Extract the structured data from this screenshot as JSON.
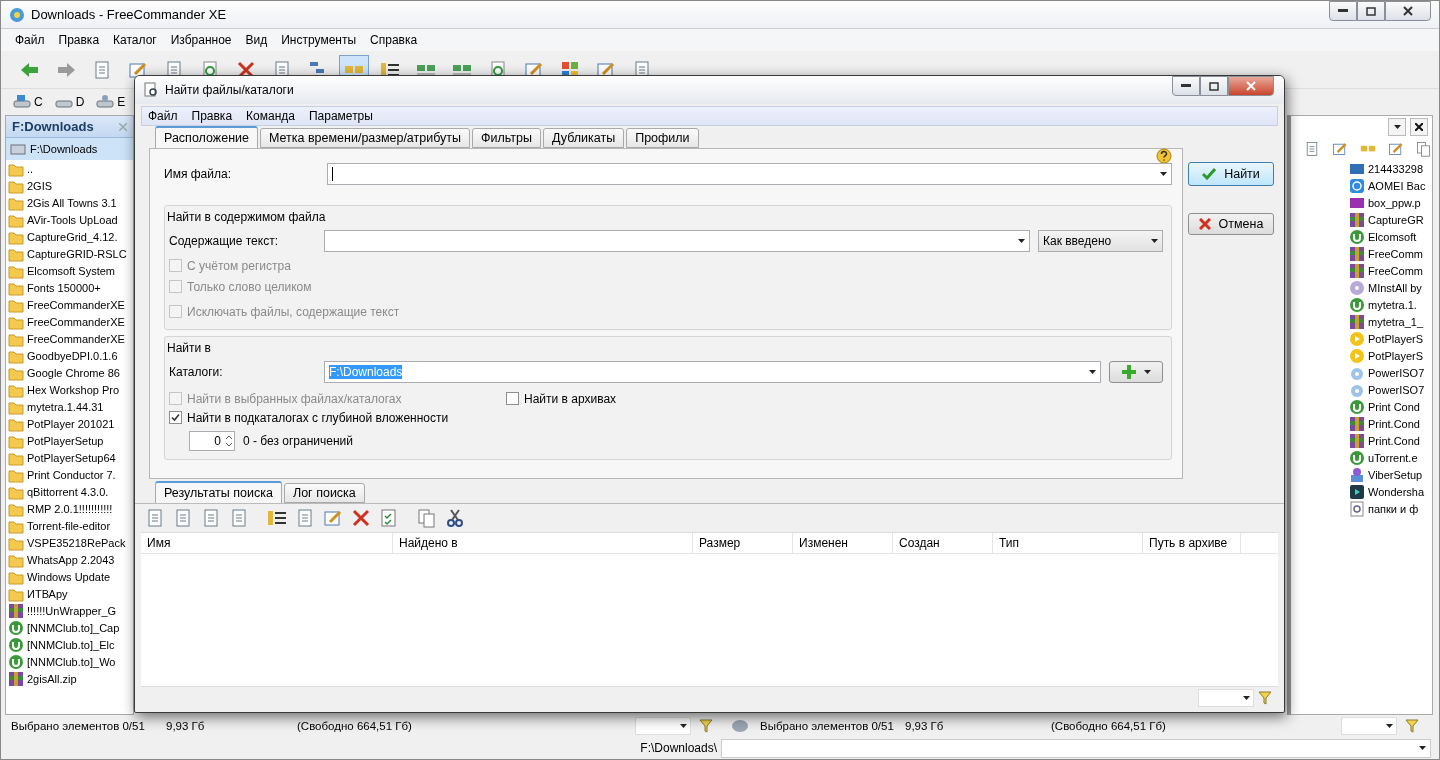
{
  "window": {
    "title": "Downloads - FreeCommander XE"
  },
  "menu": [
    "Файл",
    "Правка",
    "Каталог",
    "Избранное",
    "Вид",
    "Инструменты",
    "Справка"
  ],
  "drives": [
    {
      "label": "C",
      "kind": "system"
    },
    {
      "label": "D",
      "kind": "disk"
    },
    {
      "label": "E",
      "kind": "network"
    }
  ],
  "left_panel": {
    "tab": "F:Downloads",
    "path": "F:\\Downloads",
    "items": [
      {
        "name": "..",
        "kind": "folder"
      },
      {
        "name": "2GIS",
        "kind": "folder"
      },
      {
        "name": "2Gis All Towns 3.1",
        "kind": "folder"
      },
      {
        "name": "AVir-Tools UpLoad",
        "kind": "folder"
      },
      {
        "name": "CaptureGrid_4.12.",
        "kind": "folder"
      },
      {
        "name": "CaptureGRID-RSLC",
        "kind": "folder"
      },
      {
        "name": "Elcomsoft System",
        "kind": "folder"
      },
      {
        "name": "Fonts 150000+",
        "kind": "folder"
      },
      {
        "name": "FreeCommanderXE",
        "kind": "folder"
      },
      {
        "name": "FreeCommanderXE",
        "kind": "folder"
      },
      {
        "name": "FreeCommanderXE",
        "kind": "folder"
      },
      {
        "name": "GoodbyeDPI.0.1.6",
        "kind": "folder"
      },
      {
        "name": "Google Chrome 86",
        "kind": "folder"
      },
      {
        "name": "Hex Workshop Pro",
        "kind": "folder"
      },
      {
        "name": "mytetra.1.44.31",
        "kind": "folder"
      },
      {
        "name": "PotPlayer 201021",
        "kind": "folder"
      },
      {
        "name": "PotPlayerSetup",
        "kind": "folder"
      },
      {
        "name": "PotPlayerSetup64",
        "kind": "folder"
      },
      {
        "name": "Print Conductor 7.",
        "kind": "folder"
      },
      {
        "name": "qBittorrent 4.3.0.",
        "kind": "folder"
      },
      {
        "name": "RMP 2.0.1!!!!!!!!!!!",
        "kind": "folder"
      },
      {
        "name": "Torrent-file-editor",
        "kind": "folder"
      },
      {
        "name": "VSPE35218RePack",
        "kind": "folder"
      },
      {
        "name": "WhatsApp 2.2043",
        "kind": "folder"
      },
      {
        "name": "Windows Update",
        "kind": "folder"
      },
      {
        "name": "ИТВАру",
        "kind": "folder"
      },
      {
        "name": "!!!!!!UnWrapper_G",
        "kind": "archive"
      },
      {
        "name": "[NNMClub.to]_Cap",
        "kind": "torrent"
      },
      {
        "name": "[NNMClub.to]_Elc",
        "kind": "torrent"
      },
      {
        "name": "[NNMClub.to]_Wo",
        "kind": "torrent"
      },
      {
        "name": "2gisAll.zip",
        "kind": "archive"
      }
    ]
  },
  "right_panel": {
    "items": [
      {
        "name": "214433298",
        "kind": "gif"
      },
      {
        "name": "AOMEI Bac",
        "kind": "app"
      },
      {
        "name": "box_ppw.p",
        "kind": "png"
      },
      {
        "name": "CaptureGR",
        "kind": "archive"
      },
      {
        "name": "Elcomsoft",
        "kind": "torrent"
      },
      {
        "name": "FreeComm",
        "kind": "archive"
      },
      {
        "name": "FreeComm",
        "kind": "archive"
      },
      {
        "name": "MInstAll by",
        "kind": "disc"
      },
      {
        "name": "mytetra.1.",
        "kind": "torrent"
      },
      {
        "name": "mytetra_1_",
        "kind": "archive"
      },
      {
        "name": "PotPlayerS",
        "kind": "player"
      },
      {
        "name": "PotPlayerS",
        "kind": "player"
      },
      {
        "name": "PowerISO7",
        "kind": "iso"
      },
      {
        "name": "PowerISO7",
        "kind": "iso"
      },
      {
        "name": "Print Cond",
        "kind": "torrent"
      },
      {
        "name": "Print.Cond",
        "kind": "archive"
      },
      {
        "name": "Print.Cond",
        "kind": "archive"
      },
      {
        "name": "uTorrent.e",
        "kind": "torrent"
      },
      {
        "name": "ViberSetup",
        "kind": "installer"
      },
      {
        "name": "Wondersha",
        "kind": "dark"
      },
      {
        "name": "папки и ф",
        "kind": "shortcut"
      }
    ]
  },
  "status_bar": [
    {
      "selected": "Выбрано элементов 0/51",
      "size": "9,93 Гб",
      "free": "(Свободно 664,51 Гб)"
    },
    {
      "selected": "Выбрано элементов 0/51",
      "size": "9,93 Гб",
      "free": "(Свободно 664,51 Гб)"
    }
  ],
  "path_bar": {
    "path": "F:\\Downloads\\"
  },
  "dialog": {
    "title": "Найти файлы/каталоги",
    "menu": [
      "Файл",
      "Правка",
      "Команда",
      "Параметры"
    ],
    "tabs": [
      {
        "label": "Расположение",
        "selected": true
      },
      {
        "label": "Метка времени/размер/атрибуты",
        "selected": false
      },
      {
        "label": "Фильтры",
        "selected": false
      },
      {
        "label": "Дубликаты",
        "selected": false
      },
      {
        "label": "Профили",
        "selected": false
      }
    ],
    "file_name_label": "Имя файла:",
    "content_group": {
      "title": "Найти в содержимом файла",
      "text_label": "Содержащие текст:",
      "match_mode": "Как введено",
      "options": [
        {
          "label": "С учётом регистра",
          "checked": false,
          "disabled": true
        },
        {
          "label": "Только слово целиком",
          "checked": false,
          "disabled": true
        },
        {
          "label": "Исключать файлы, содержащие текст",
          "checked": false,
          "disabled": true
        }
      ]
    },
    "location_group": {
      "title": "Найти в",
      "folders_label": "Каталоги:",
      "folders_value": "F:\\Downloads",
      "options": [
        {
          "label": "Найти в выбранных файлах/каталогах",
          "checked": false,
          "disabled": true
        },
        {
          "label": "Найти в архивах",
          "checked": false,
          "disabled": false
        },
        {
          "label": "Найти в подкаталогах с глубиной вложенности",
          "checked": true,
          "disabled": false
        }
      ],
      "depth": "0",
      "depth_hint": "0 - без ограничений"
    },
    "buttons": [
      {
        "label": "Найти",
        "kind": "find"
      },
      {
        "label": "Отмена",
        "kind": "cancel"
      }
    ],
    "result_tabs": [
      {
        "label": "Результаты поиска",
        "selected": true
      },
      {
        "label": "Лог поиска",
        "selected": false
      }
    ],
    "table": {
      "columns": [
        "Имя",
        "Найдено в",
        "Размер",
        "Изменен",
        "Создан",
        "Тип",
        "Путь в архиве"
      ]
    }
  }
}
